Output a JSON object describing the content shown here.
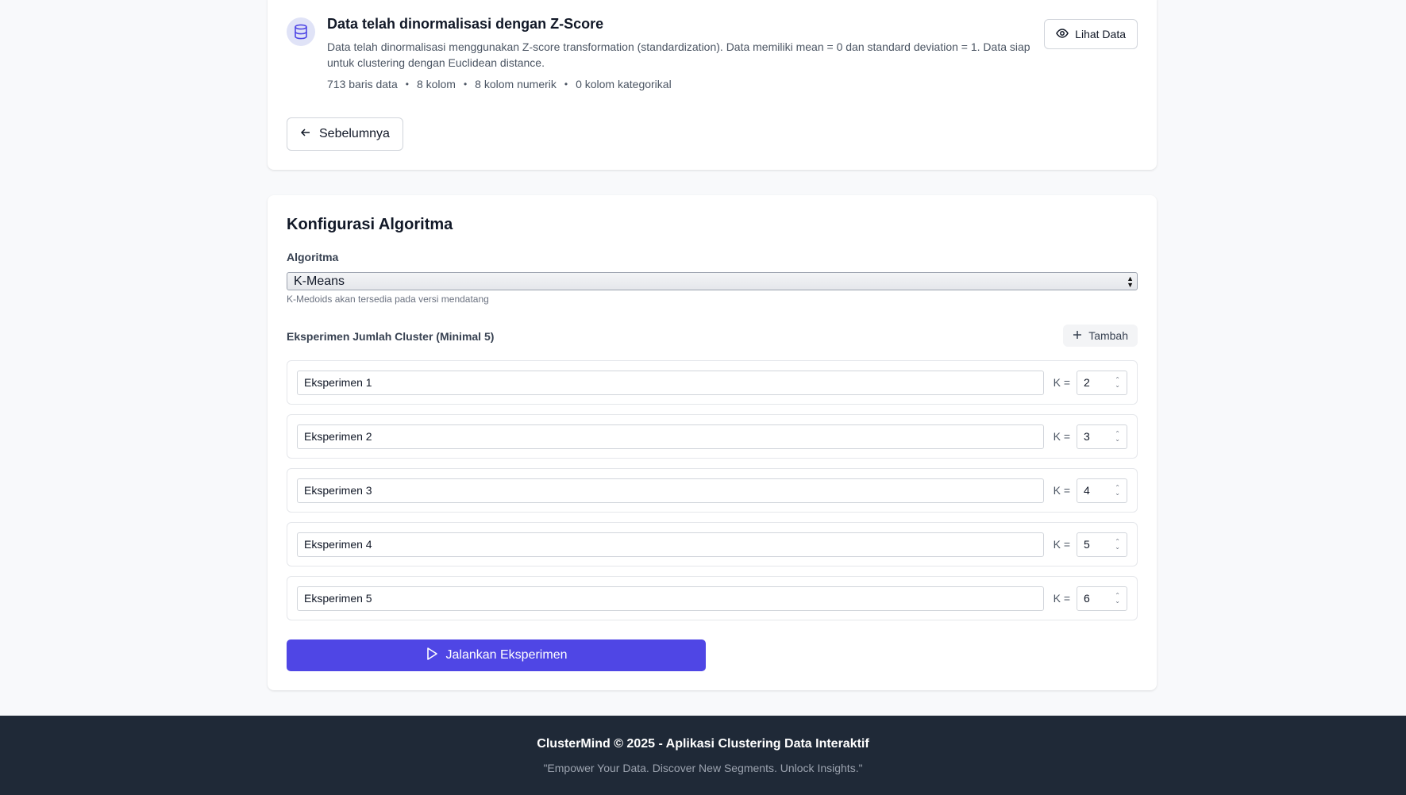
{
  "colors": {
    "primary": "#4f46e5",
    "footer_bg": "#1f2937",
    "page_bg": "#f8f9fb",
    "icon_bg": "#e0e3f7"
  },
  "normalization_info": {
    "icon": "database-icon",
    "title": "Data telah dinormalisasi dengan Z-Score",
    "description": "Data telah dinormalisasi menggunakan Z-score transformation (standardization). Data memiliki mean = 0 dan standard deviation = 1. Data siap untuk clustering dengan Euclidean distance.",
    "stats": {
      "rows": "713 baris data",
      "columns": "8 kolom",
      "numeric": "8 kolom numerik",
      "categorical": "0 kolom kategorikal"
    },
    "separator": "•",
    "view_button": {
      "icon": "eye-icon",
      "label": "Lihat Data"
    },
    "prev_button": {
      "icon": "arrow-left-icon",
      "label": "Sebelumnya"
    }
  },
  "config": {
    "title": "Konfigurasi Algoritma",
    "algorithm": {
      "label": "Algoritma",
      "selected": "K-Means",
      "hint": "K-Medoids akan tersedia pada versi mendatang"
    },
    "experiments": {
      "heading": "Eksperimen Jumlah Cluster (Minimal 5)",
      "add_button": {
        "icon": "plus-icon",
        "label": "Tambah"
      },
      "k_label": "K =",
      "items": [
        {
          "name": "Eksperimen 1",
          "k": "2"
        },
        {
          "name": "Eksperimen 2",
          "k": "3"
        },
        {
          "name": "Eksperimen 3",
          "k": "4"
        },
        {
          "name": "Eksperimen 4",
          "k": "5"
        },
        {
          "name": "Eksperimen 5",
          "k": "6"
        }
      ]
    },
    "run_button": {
      "icon": "play-icon",
      "label": "Jalankan Eksperimen"
    }
  },
  "footer": {
    "title": "ClusterMind © 2025 - Aplikasi Clustering Data Interaktif",
    "tagline": "\"Empower Your Data. Discover New Segments. Unlock Insights.\""
  }
}
